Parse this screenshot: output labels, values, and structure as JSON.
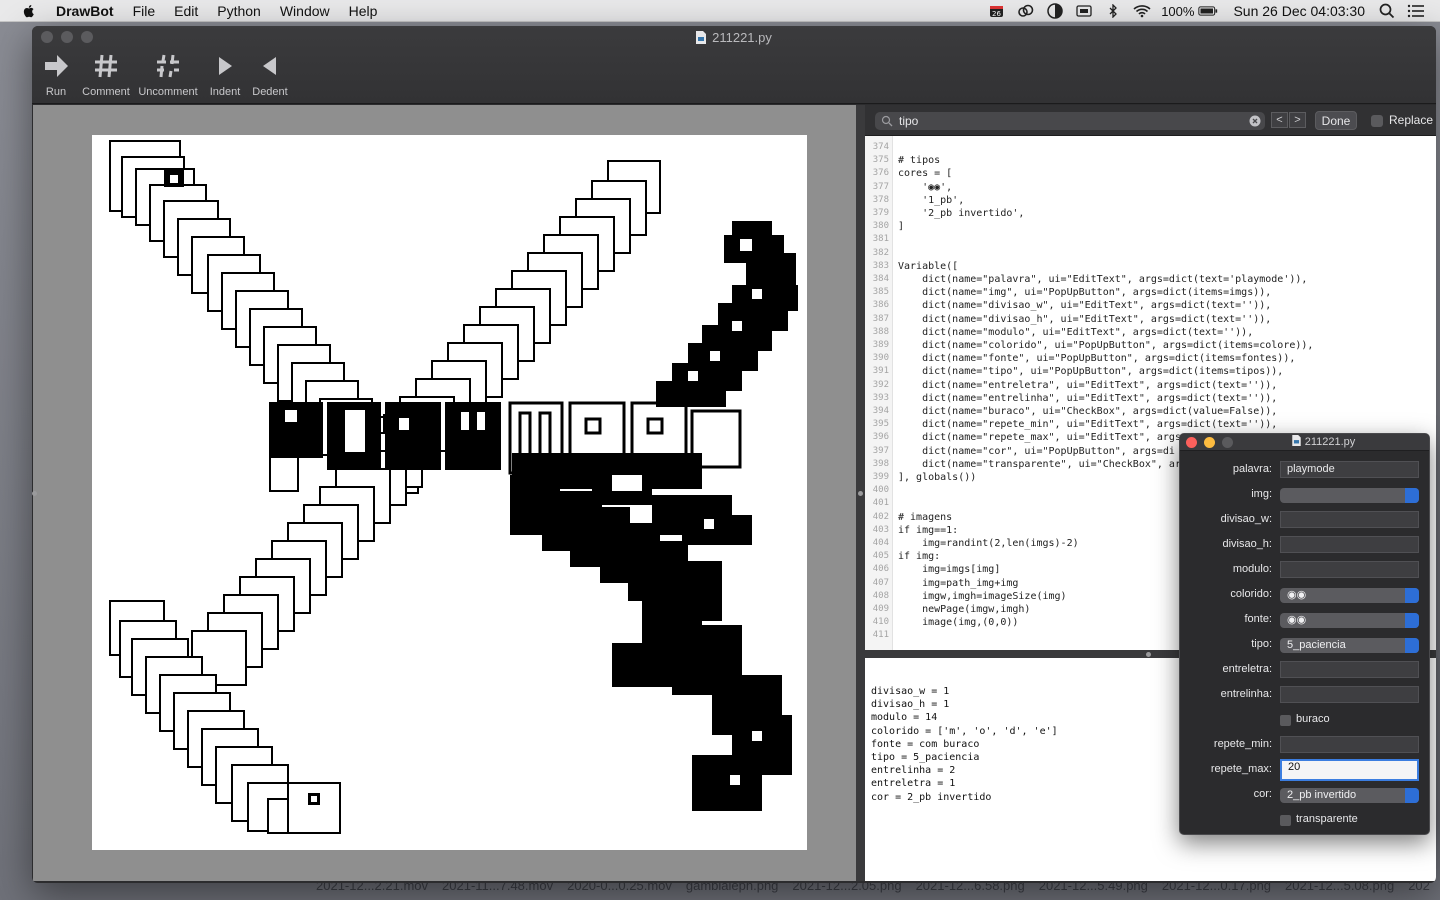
{
  "menubar": {
    "app_name": "DrawBot",
    "items": [
      "File",
      "Edit",
      "Python",
      "Window",
      "Help"
    ],
    "battery": "100%",
    "clock": "Sun 26 Dec  04:03:30",
    "calendar_badge": "26"
  },
  "window": {
    "title": "211221.py"
  },
  "toolbar": {
    "run": "Run",
    "comment": "Comment",
    "uncomment": "Uncomment",
    "indent": "Indent",
    "dedent": "Dedent"
  },
  "find": {
    "query": "tipo",
    "prev": "<",
    "next": ">",
    "done": "Done",
    "replace": "Replace"
  },
  "code_lines": [
    {
      "n": "374",
      "t": ""
    },
    {
      "n": "375",
      "t": "# tipos"
    },
    {
      "n": "376",
      "t": "cores = ["
    },
    {
      "n": "377",
      "t": "    '◉◉',"
    },
    {
      "n": "378",
      "t": "    '1_pb',"
    },
    {
      "n": "379",
      "t": "    '2_pb invertido',"
    },
    {
      "n": "380",
      "t": "]"
    },
    {
      "n": "381",
      "t": ""
    },
    {
      "n": "382",
      "t": ""
    },
    {
      "n": "383",
      "t": "Variable(["
    },
    {
      "n": "384",
      "t": "    dict(name=\"palavra\", ui=\"EditText\", args=dict(text='playmode')),"
    },
    {
      "n": "385",
      "t": "    dict(name=\"img\", ui=\"PopUpButton\", args=dict(items=imgs)),"
    },
    {
      "n": "386",
      "t": "    dict(name=\"divisao_w\", ui=\"EditText\", args=dict(text='')),"
    },
    {
      "n": "387",
      "t": "    dict(name=\"divisao_h\", ui=\"EditText\", args=dict(text='')),"
    },
    {
      "n": "388",
      "t": "    dict(name=\"modulo\", ui=\"EditText\", args=dict(text='')),"
    },
    {
      "n": "389",
      "t": "    dict(name=\"colorido\", ui=\"PopUpButton\", args=dict(items=colore)),"
    },
    {
      "n": "390",
      "t": "    dict(name=\"fonte\", ui=\"PopUpButton\", args=dict(items=fontes)),"
    },
    {
      "n": "391",
      "t": "    dict(name=\"tipo\", ui=\"PopUpButton\", args=dict(items=tipos)),"
    },
    {
      "n": "392",
      "t": "    dict(name=\"entreletra\", ui=\"EditText\", args=dict(text='')),"
    },
    {
      "n": "393",
      "t": "    dict(name=\"entrelinha\", ui=\"EditText\", args=dict(text='')),"
    },
    {
      "n": "394",
      "t": "    dict(name=\"buraco\", ui=\"CheckBox\", args=dict(value=False)),"
    },
    {
      "n": "395",
      "t": "    dict(name=\"repete_min\", ui=\"EditText\", args=dict(text='')),"
    },
    {
      "n": "396",
      "t": "    dict(name=\"repete_max\", ui=\"EditText\", args"
    },
    {
      "n": "397",
      "t": "    dict(name=\"cor\", ui=\"PopUpButton\", args=di"
    },
    {
      "n": "398",
      "t": "    dict(name=\"transparente\", ui=\"CheckBox\", ar"
    },
    {
      "n": "399",
      "t": "], globals())"
    },
    {
      "n": "400",
      "t": ""
    },
    {
      "n": "401",
      "t": ""
    },
    {
      "n": "402",
      "t": "# imagens"
    },
    {
      "n": "403",
      "t": "if img==1:"
    },
    {
      "n": "404",
      "t": "    img=randint(2,len(imgs)-2)"
    },
    {
      "n": "405",
      "t": "if img:"
    },
    {
      "n": "406",
      "t": "    img=imgs[img]"
    },
    {
      "n": "407",
      "t": "    img=path_img+img"
    },
    {
      "n": "408",
      "t": "    imgw,imgh=imageSize(img)"
    },
    {
      "n": "409",
      "t": "    newPage(imgw,imgh)"
    },
    {
      "n": "410",
      "t": "    image(img,(0,0))"
    },
    {
      "n": "411",
      "t": ""
    }
  ],
  "output_lines": [
    "divisao_w = 1",
    "divisao_h = 1",
    "modulo = 14",
    "colorido = ['m', 'o', 'd', 'e']",
    "fonte = com buraco",
    "tipo = 5_paciencia",
    "entrelinha = 2",
    "entreletra = 1",
    "cor = 2_pb invertido"
  ],
  "palette": {
    "title": "211221.py",
    "palavra_label": "palavra:",
    "palavra_value": "playmode",
    "img_label": "img:",
    "img_value": "",
    "divisao_w_label": "divisao_w:",
    "divisao_h_label": "divisao_h:",
    "modulo_label": "modulo:",
    "colorido_label": "colorido:",
    "colorido_value": "◉◉",
    "fonte_label": "fonte:",
    "fonte_value": "◉◉",
    "tipo_label": "tipo:",
    "tipo_value": "5_paciencia",
    "entreletra_label": "entreletra:",
    "entrelinha_label": "entrelinha:",
    "buraco_label": "buraco",
    "repete_min_label": "repete_min:",
    "repete_max_label": "repete_max:",
    "repete_max_value": "20",
    "cor_label": "cor:",
    "cor_value": "2_pb invertido",
    "transparente_label": "transparente"
  },
  "desktop_files": [
    "2021-12...2.21.mov",
    "2021-11...7.48.mov",
    "2020-0...0.25.mov",
    "gambialeph.png",
    "2021-12...2.05.png",
    "2021-12...6.58.png",
    "2021-12...5.49.png",
    "2021-12...0.17.png",
    "2021-12...5.08.png",
    "202"
  ],
  "colors": {
    "accent": "#2d6ed6",
    "close": "#fc605c",
    "minimize": "#fdbc40",
    "zoom": "#5a5a5d"
  }
}
